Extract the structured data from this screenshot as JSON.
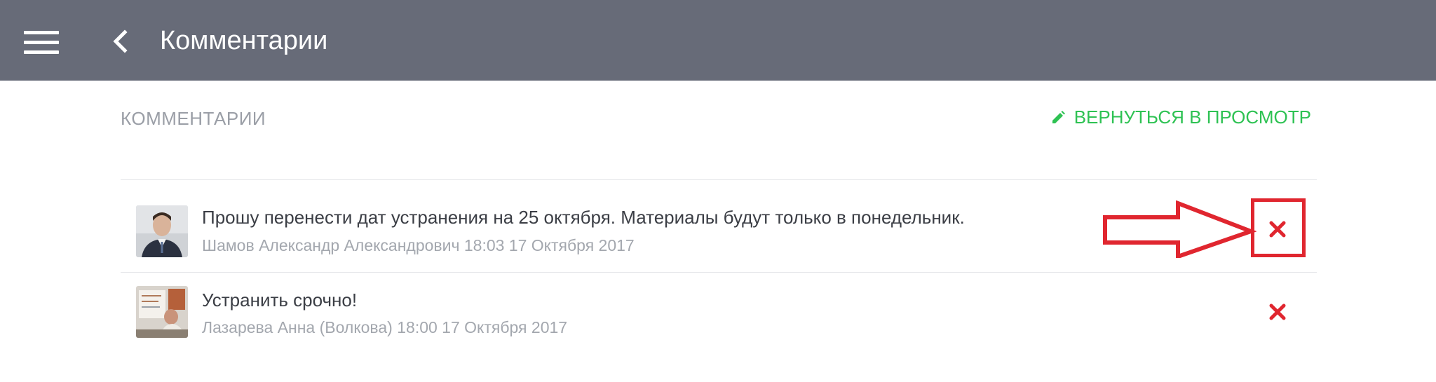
{
  "header": {
    "title": "Комментарии"
  },
  "toolbar": {
    "section_label": "КОММЕНТАРИИ",
    "return_label": "ВЕРНУТЬСЯ В ПРОСМОТР"
  },
  "comments": [
    {
      "text": "Прошу перенести дат устранения на 25 октября. Материалы будут только в понедельник.",
      "meta": "Шамов Александр Александрович 18:03 17 Октября 2017"
    },
    {
      "text": "Устранить срочно!",
      "meta": "Лазарева Анна (Волкова) 18:00 17 Октября 2017"
    }
  ],
  "icons": {
    "menu": "hamburger-menu-icon",
    "back": "chevron-left-icon",
    "edit": "pencil-icon",
    "delete": "close-x-icon"
  },
  "colors": {
    "header_bg": "#676b78",
    "accent_green": "#2ec253",
    "delete_red": "#e0262f",
    "annotation_red": "#e0262f",
    "muted_text": "#a3a7ae"
  }
}
